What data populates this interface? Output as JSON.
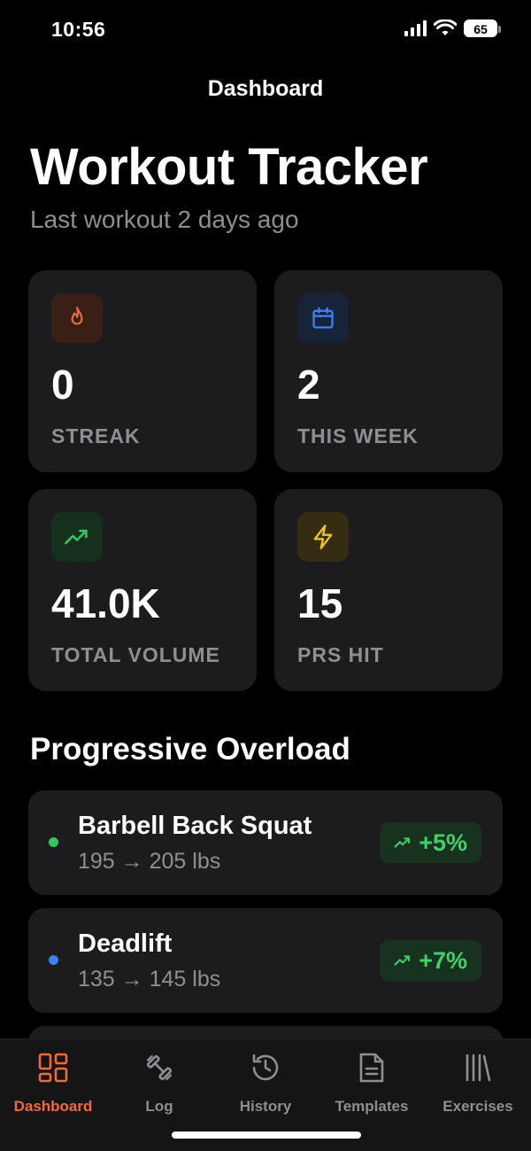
{
  "status_bar": {
    "time": "10:56",
    "battery": "65"
  },
  "nav": {
    "title": "Dashboard"
  },
  "header": {
    "title": "Workout Tracker",
    "subtitle": "Last workout 2 days ago"
  },
  "stats": [
    {
      "value": "0",
      "label": "STREAK",
      "icon": "flame-icon",
      "color": "#f26b3a",
      "bg": "#3a1f17"
    },
    {
      "value": "2",
      "label": "THIS WEEK",
      "icon": "calendar-icon",
      "color": "#3b82f6",
      "bg": "#172338"
    },
    {
      "value": "41.0K",
      "label": "TOTAL VOLUME",
      "icon": "trending-up-icon",
      "color": "#34c759",
      "bg": "#15301c"
    },
    {
      "value": "15",
      "label": "PRS HIT",
      "icon": "lightning-icon",
      "color": "#f5c518",
      "bg": "#352d12"
    }
  ],
  "progressive_overload": {
    "title": "Progressive Overload",
    "items": [
      {
        "name": "Barbell Back Squat",
        "detail": "195 → 205 lbs",
        "change": "+5%",
        "dot_color": "#34c759"
      },
      {
        "name": "Deadlift",
        "detail": "135 → 145 lbs",
        "change": "+7%",
        "dot_color": "#3b82f6"
      }
    ]
  },
  "tabs": [
    {
      "label": "Dashboard",
      "icon": "dashboard-grid-icon",
      "active": true
    },
    {
      "label": "Log",
      "icon": "dumbbell-icon",
      "active": false
    },
    {
      "label": "History",
      "icon": "history-clock-icon",
      "active": false
    },
    {
      "label": "Templates",
      "icon": "document-icon",
      "active": false
    },
    {
      "label": "Exercises",
      "icon": "library-icon",
      "active": false
    }
  ],
  "colors": {
    "accent": "#f26b3a",
    "card": "#1c1c1e",
    "muted": "#8e8e93",
    "positive": "#3fd068"
  }
}
